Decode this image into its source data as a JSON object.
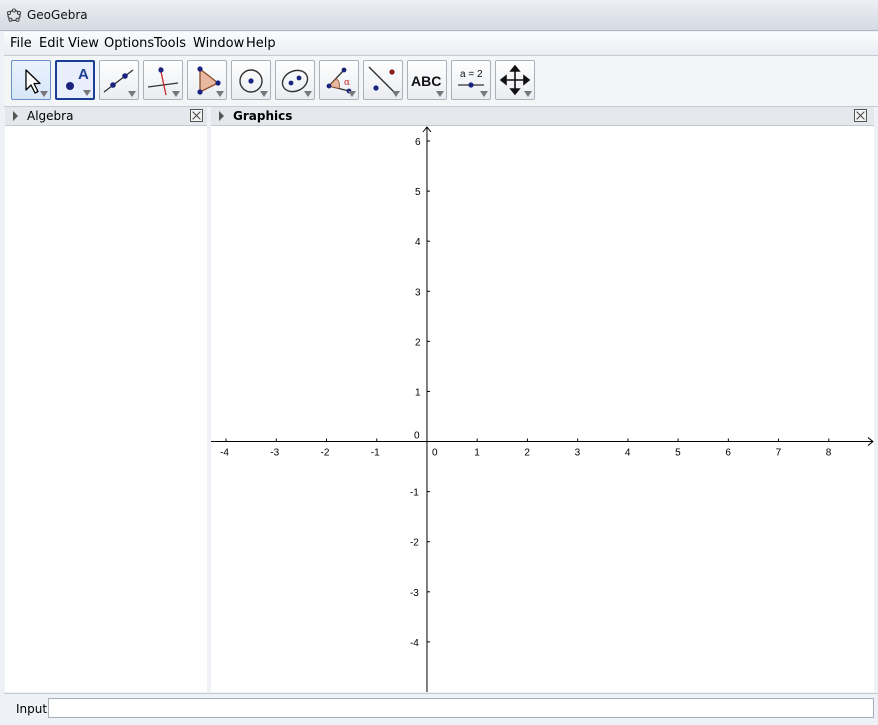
{
  "window": {
    "title": "GeoGebra"
  },
  "menu": {
    "items": [
      "File",
      "Edit",
      "View",
      "Options",
      "Tools",
      "Window",
      "Help"
    ]
  },
  "toolbar": {
    "tools": [
      {
        "icon": "move-arrow-icon"
      },
      {
        "icon": "new-point-icon",
        "label": "A"
      },
      {
        "icon": "line-through-two-points-icon"
      },
      {
        "icon": "perpendicular-line-icon"
      },
      {
        "icon": "polygon-icon"
      },
      {
        "icon": "circle-center-point-icon"
      },
      {
        "icon": "conic-five-points-icon"
      },
      {
        "icon": "angle-icon",
        "label": "α"
      },
      {
        "icon": "reflect-about-line-icon"
      },
      {
        "icon": "insert-text-icon",
        "label": "ABC"
      },
      {
        "icon": "slider-icon",
        "label": "a = 2"
      },
      {
        "icon": "move-graphics-view-icon"
      }
    ],
    "active_index": 1
  },
  "algebra": {
    "title": "Algebra"
  },
  "graphics": {
    "title": "Graphics",
    "x_ticks": [
      "-4",
      "-3",
      "-2",
      "-1",
      "0",
      "1",
      "2",
      "3",
      "4",
      "5",
      "6",
      "7",
      "8"
    ],
    "y_ticks": [
      "6",
      "5",
      "4",
      "3",
      "2",
      "1",
      "0",
      "-1",
      "-2",
      "-3",
      "-4"
    ],
    "x_range": [
      -4.3,
      8.9
    ],
    "y_range": [
      -5.0,
      6.3
    ]
  },
  "input": {
    "label": "Input:",
    "value": ""
  },
  "colors": {
    "accent": "#1c3f94",
    "point": "#1a237e",
    "axis": "#000000"
  }
}
